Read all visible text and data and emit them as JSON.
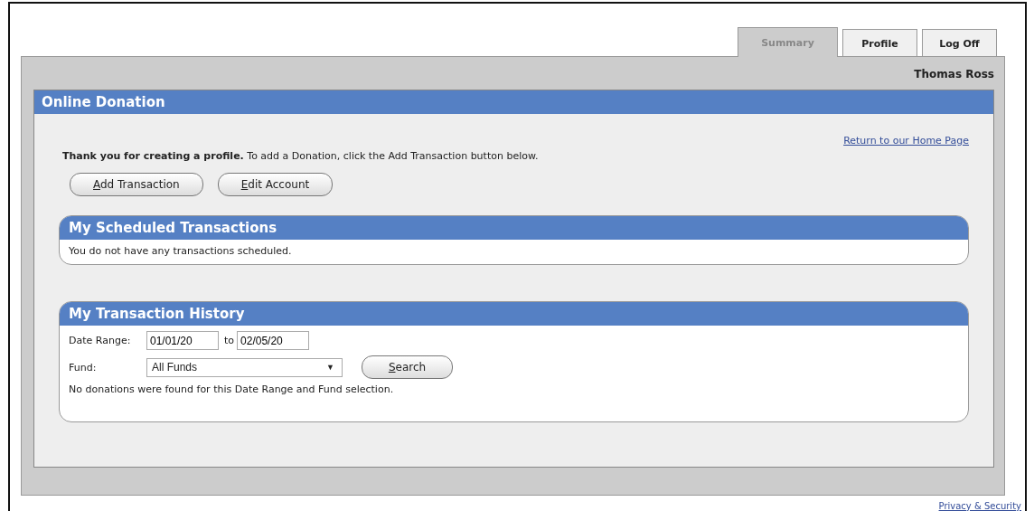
{
  "tabs": [
    {
      "label": "Summary",
      "selected": true
    },
    {
      "label": "Profile",
      "selected": false
    },
    {
      "label": "Log Off",
      "selected": false
    }
  ],
  "user_name": "Thomas Ross",
  "panel": {
    "title": "Online Donation",
    "home_link": "Return to our Home Page",
    "intro": "**Thank you for creating a profile.** To add a Donation, click the Add Transaction button below.",
    "buttons": [
      "Add Transaction",
      "Edit Account"
    ],
    "scheduled": {
      "title": "My Scheduled Transactions",
      "message": "You do not have any transactions scheduled."
    },
    "history": {
      "title": "My Transaction History",
      "date_label": "Date Range:",
      "date_from": "01/01/20",
      "to_label": "to",
      "date_to": "02/05/20",
      "fund_label": "Fund:",
      "fund_value": "All Funds",
      "fund_arrow": "▼",
      "search_button": "Search",
      "message": "No donations were found for this Date Range and Fund selection."
    }
  },
  "footer_link": "Privacy & Security"
}
